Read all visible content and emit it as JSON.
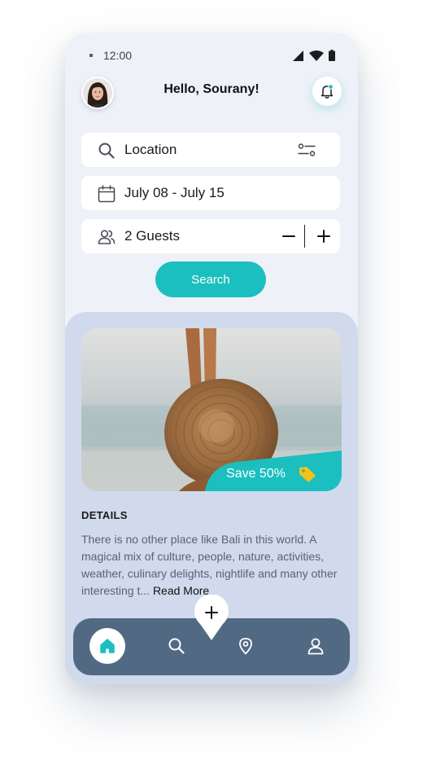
{
  "status_bar": {
    "time": "12:00"
  },
  "header": {
    "greeting": "Hello, Sourany!"
  },
  "search_form": {
    "location": "Location",
    "dates": "July 08 - July 15",
    "guests": "2 Guests",
    "search_label": "Search"
  },
  "card": {
    "save_label": "Save 50%",
    "details_title": "DETAILS",
    "details_text": "There is no other place like Bali in this world. A magical mix of culture, people, nature, activities, weather, culinary delights, nightlife and many other interesting t...",
    "read_more": "Read More"
  },
  "colors": {
    "accent": "#1bbfbf",
    "nav_background": "#526984",
    "card_section_background": "#d0daec",
    "app_background": "#eef2f8",
    "tag_icon": "#f3c21a"
  },
  "icons": {
    "bell": "bell-icon",
    "search": "search-icon",
    "filter": "filter-icon",
    "calendar": "calendar-icon",
    "guests": "users-icon",
    "tag": "tag-icon",
    "nav": [
      "home-icon",
      "search-icon",
      "map-pin-icon",
      "user-icon"
    ],
    "fab": "plus-icon"
  }
}
